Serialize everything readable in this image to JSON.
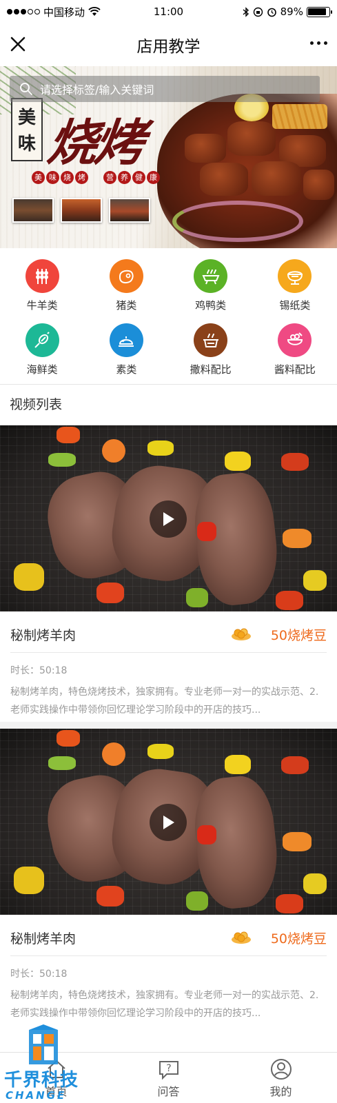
{
  "status_bar": {
    "carrier": "中国移动",
    "time": "11:00",
    "battery": "89%",
    "battery_level": 0.89
  },
  "nav": {
    "title": "店用教学",
    "close_icon": "close-icon",
    "more_icon": "more-icon"
  },
  "banner": {
    "search_placeholder": "请选择标签/输入关键词",
    "small_chars": [
      "美",
      "味"
    ],
    "big_title": "烧烤",
    "tags": [
      [
        "美",
        "味",
        "烧",
        "烤"
      ],
      [
        "营",
        "养",
        "健",
        "康"
      ]
    ]
  },
  "categories": [
    {
      "label": "牛羊类",
      "icon": "skewer-icon",
      "color": "#f0453c"
    },
    {
      "label": "猪类",
      "icon": "meat-icon",
      "color": "#f47a1c"
    },
    {
      "label": "鸡鸭类",
      "icon": "grill-tray-icon",
      "color": "#5bb226"
    },
    {
      "label": "锡纸类",
      "icon": "grill-icon",
      "color": "#f6a81c"
    },
    {
      "label": "海鲜类",
      "icon": "seafood-icon",
      "color": "#1db896"
    },
    {
      "label": "素类",
      "icon": "dish-icon",
      "color": "#1b8ed8"
    },
    {
      "label": "撒料配比",
      "icon": "pot-icon",
      "color": "#8a4119"
    },
    {
      "label": "酱料配比",
      "icon": "bowl-icon",
      "color": "#ef4a83"
    }
  ],
  "section": {
    "title": "视频列表"
  },
  "videos": [
    {
      "title": "秘制烤羊肉",
      "price": "50烧烤豆",
      "duration": "时长：50:18",
      "description": "秘制烤羊肉，特色烧烤技术，独家拥有。专业老师一对一的实战示范、2.老师实践操作中带领你回忆理论学习阶段中的开店的技巧..."
    },
    {
      "title": "秘制烤羊肉",
      "price": "50烧烤豆",
      "duration": "时长：50:18",
      "description": "秘制烤羊肉，特色烧烤技术，独家拥有。专业老师一对一的实战示范、2.老师实践操作中带领你回忆理论学习阶段中的开店的技巧..."
    }
  ],
  "tab_bar": {
    "items": [
      {
        "label": "首页",
        "icon": "home-icon"
      },
      {
        "label": "问答",
        "icon": "qa-icon"
      },
      {
        "label": "我的",
        "icon": "profile-icon"
      }
    ]
  },
  "watermark": {
    "text": "千界科技",
    "sub": "CHANGE"
  },
  "colors": {
    "accent": "#ee6a1c",
    "text_primary": "#333333",
    "text_secondary": "#999999"
  }
}
